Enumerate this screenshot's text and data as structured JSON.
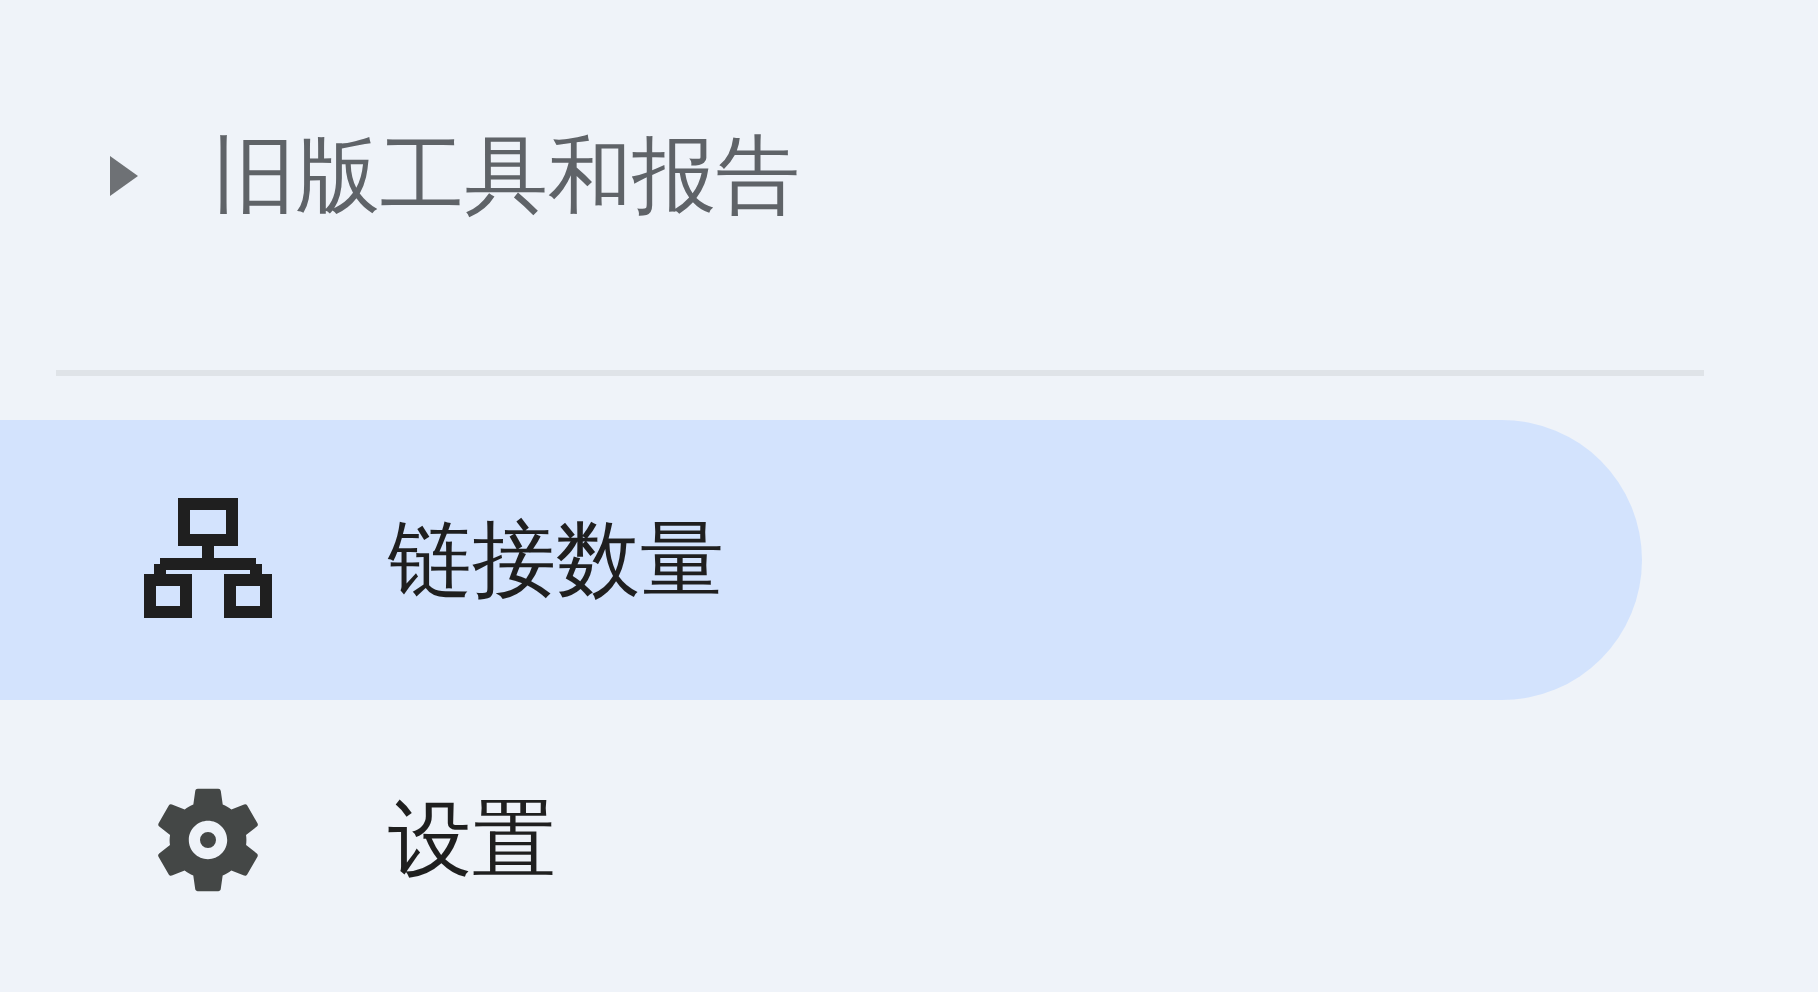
{
  "sections": [
    {
      "label": "旧版工具和报告",
      "expanded": false
    }
  ],
  "nav_items": [
    {
      "label": "链接数量",
      "kind": "links",
      "selected": true
    },
    {
      "label": "设置",
      "kind": "settings",
      "selected": false
    }
  ]
}
